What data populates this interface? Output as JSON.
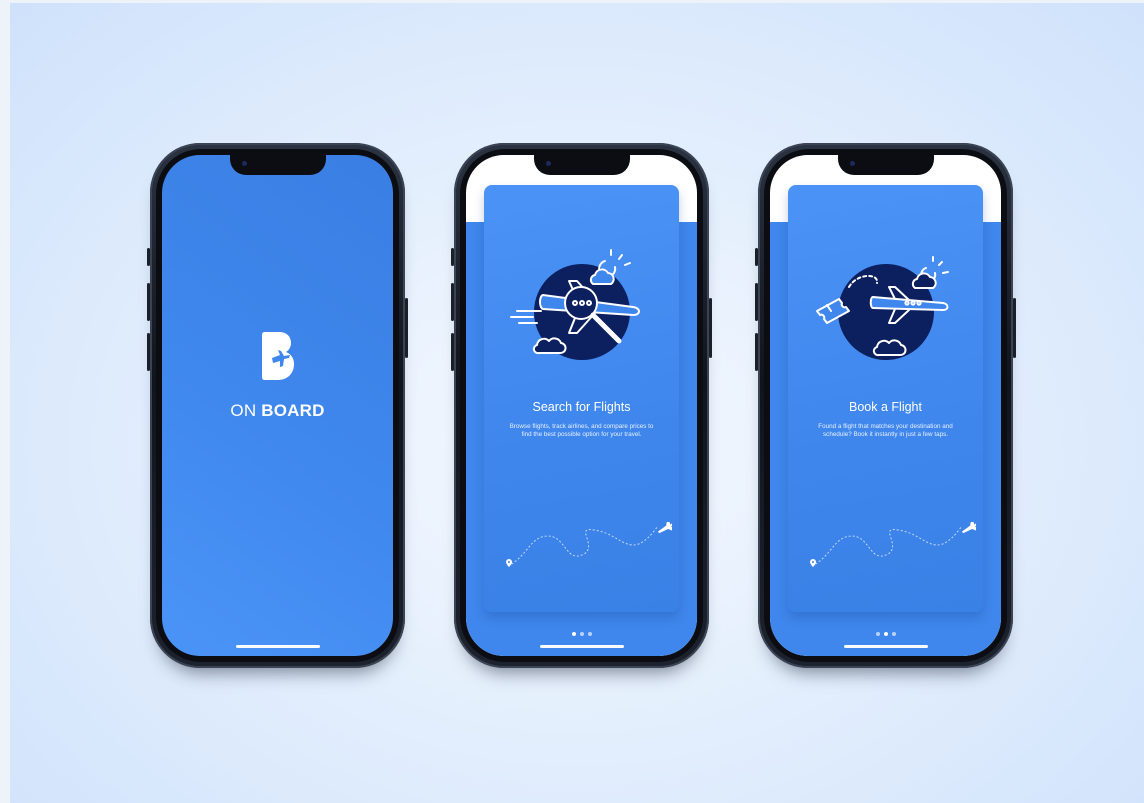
{
  "splash": {
    "brand_light": "ON",
    "brand_bold": "BOARD",
    "logo_letter": "B"
  },
  "screens": [
    {
      "title": "Search for Flights",
      "description": "Browse flights, track airlines, and compare prices to find the best possible option for your travel.",
      "active_dot": 0
    },
    {
      "title": "Book a Flight",
      "description": "Found a flight that matches your destination and schedule? Book it instantly in just a few taps.",
      "active_dot": 1
    }
  ],
  "colors": {
    "primary_blue": "#3f87ec",
    "navy_circle": "#0c1f5e",
    "white": "#ffffff"
  },
  "icons": [
    "airplane-search-illustration",
    "airplane-ticket-illustration",
    "location-pin-icon",
    "airplane-icon"
  ]
}
